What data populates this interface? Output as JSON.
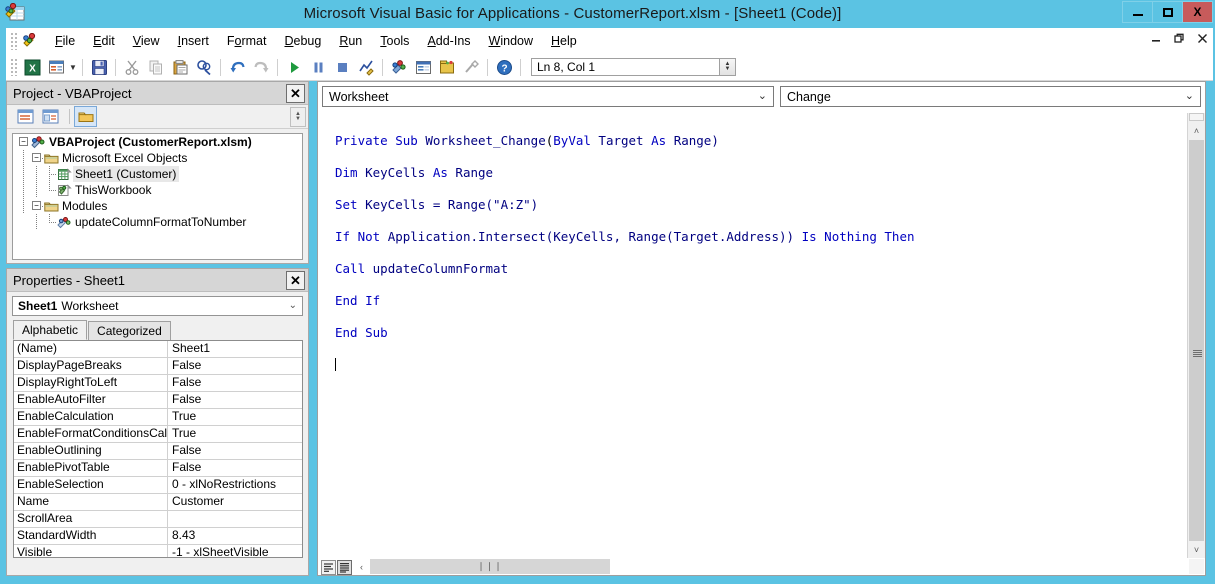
{
  "window": {
    "title": "Microsoft Visual Basic for Applications - CustomerReport.xlsm - [Sheet1 (Code)]",
    "app_icon": "vba-icon",
    "controls": {
      "minimize": "–",
      "maximize": "□",
      "close": "X"
    }
  },
  "menubar": {
    "items": [
      {
        "label": "File",
        "accel": "F"
      },
      {
        "label": "Edit",
        "accel": "E"
      },
      {
        "label": "View",
        "accel": "V"
      },
      {
        "label": "Insert",
        "accel": "I"
      },
      {
        "label": "Format",
        "accel": "o"
      },
      {
        "label": "Debug",
        "accel": "D"
      },
      {
        "label": "Run",
        "accel": "R"
      },
      {
        "label": "Tools",
        "accel": "T"
      },
      {
        "label": "Add-Ins",
        "accel": "A"
      },
      {
        "label": "Window",
        "accel": "W"
      },
      {
        "label": "Help",
        "accel": "H"
      }
    ],
    "doc_controls": {
      "minimize": "–",
      "restore": "❐",
      "close": "✕"
    }
  },
  "toolbar": {
    "buttons": [
      "view-excel-icon",
      "insert-userform-icon",
      "dropdown-arrow",
      "save-icon",
      "cut-icon",
      "copy-icon",
      "paste-icon",
      "find-icon",
      "undo-icon",
      "redo-icon",
      "run-icon",
      "break-icon",
      "reset-icon",
      "design-mode-icon",
      "project-explorer-icon",
      "properties-window-icon",
      "object-browser-icon",
      "toolbox-icon",
      "help-icon"
    ],
    "position_indicator": "Ln 8, Col 1"
  },
  "project_panel": {
    "title": "Project - VBAProject",
    "close_label": "✕",
    "toolbar_buttons": [
      "view-code-icon",
      "view-object-icon",
      "toggle-folders-icon"
    ],
    "tree": [
      {
        "label": "VBAProject (CustomerReport.xlsm)",
        "icon": "vbaproject-icon",
        "depth": 0,
        "expander": "-",
        "bold": true,
        "selected": false
      },
      {
        "label": "Microsoft Excel Objects",
        "icon": "folder-icon",
        "depth": 1,
        "expander": "-",
        "bold": false,
        "selected": false
      },
      {
        "label": "Sheet1 (Customer)",
        "icon": "worksheet-icon",
        "depth": 2,
        "expander": "",
        "bold": false,
        "selected": true
      },
      {
        "label": "ThisWorkbook",
        "icon": "workbook-icon",
        "depth": 2,
        "expander": "",
        "bold": false,
        "selected": false
      },
      {
        "label": "Modules",
        "icon": "folder-icon",
        "depth": 1,
        "expander": "-",
        "bold": false,
        "selected": false
      },
      {
        "label": "updateColumnFormatToNumber",
        "icon": "module-icon",
        "depth": 2,
        "expander": "",
        "bold": false,
        "selected": false
      }
    ]
  },
  "properties_panel": {
    "title": "Properties - Sheet1",
    "close_label": "✕",
    "object_selector": {
      "name": "Sheet1",
      "type": "Worksheet",
      "carat": "⌄"
    },
    "tabs": [
      {
        "label": "Alphabetic",
        "active": true
      },
      {
        "label": "Categorized",
        "active": false
      }
    ],
    "rows": [
      {
        "name": "(Name)",
        "value": "Sheet1"
      },
      {
        "name": "DisplayPageBreaks",
        "value": "False"
      },
      {
        "name": "DisplayRightToLeft",
        "value": "False"
      },
      {
        "name": "EnableAutoFilter",
        "value": "False"
      },
      {
        "name": "EnableCalculation",
        "value": "True"
      },
      {
        "name": "EnableFormatConditionsCalcul",
        "value": "True"
      },
      {
        "name": "EnableOutlining",
        "value": "False"
      },
      {
        "name": "EnablePivotTable",
        "value": "False"
      },
      {
        "name": "EnableSelection",
        "value": "0 - xlNoRestrictions"
      },
      {
        "name": "Name",
        "value": "Customer"
      },
      {
        "name": "ScrollArea",
        "value": ""
      },
      {
        "name": "StandardWidth",
        "value": "8.43"
      },
      {
        "name": "Visible",
        "value": "-1 - xlSheetVisible"
      }
    ]
  },
  "code_window": {
    "object_combo": {
      "value": "Worksheet",
      "carat": "⌄"
    },
    "procedure_combo": {
      "value": "Change",
      "carat": "⌄"
    },
    "lines": [
      [
        {
          "t": "Private Sub ",
          "c": "kw"
        },
        {
          "t": "Worksheet_Change",
          "c": "id"
        },
        {
          "t": "(",
          "c": "pl"
        },
        {
          "t": "ByVal ",
          "c": "kw"
        },
        {
          "t": "Target ",
          "c": "id"
        },
        {
          "t": "As ",
          "c": "kw"
        },
        {
          "t": "Range)",
          "c": "id"
        }
      ],
      [
        {
          "t": "Dim ",
          "c": "kw"
        },
        {
          "t": "KeyCells ",
          "c": "id"
        },
        {
          "t": "As ",
          "c": "kw"
        },
        {
          "t": "Range",
          "c": "id"
        }
      ],
      [
        {
          "t": "Set ",
          "c": "kw"
        },
        {
          "t": "KeyCells = Range(\"A:Z\")",
          "c": "id"
        }
      ],
      [
        {
          "t": "If Not ",
          "c": "kw"
        },
        {
          "t": "Application.Intersect(KeyCells, Range(Target.Address)) ",
          "c": "id"
        },
        {
          "t": "Is Nothing Then",
          "c": "kw"
        }
      ],
      [
        {
          "t": "Call ",
          "c": "kw"
        },
        {
          "t": "updateColumnFormat",
          "c": "id"
        }
      ],
      [
        {
          "t": "End If",
          "c": "kw"
        }
      ],
      [
        {
          "t": "End Sub",
          "c": "kw"
        }
      ],
      [
        {
          "t": "",
          "c": "pl"
        }
      ]
    ],
    "cursor_line": 8,
    "view_buttons": [
      "procedure-view-icon",
      "full-module-view-icon"
    ],
    "hscroll": {
      "left_arrow": "‹",
      "right_arrow": "›",
      "thumb_grip": "❘❘❘"
    },
    "vscroll": {
      "up_arrow": "˄",
      "down_arrow": "˅"
    }
  },
  "colors": {
    "title_bar": "#5BC3E3",
    "close_button": "#C75B5B",
    "panel_title": "#D6D6D6",
    "panel_bg": "#F0F0F0",
    "keyword_blue": "#0000C0",
    "identifier": "#000080",
    "selection_bg": "#E8E8E8"
  }
}
